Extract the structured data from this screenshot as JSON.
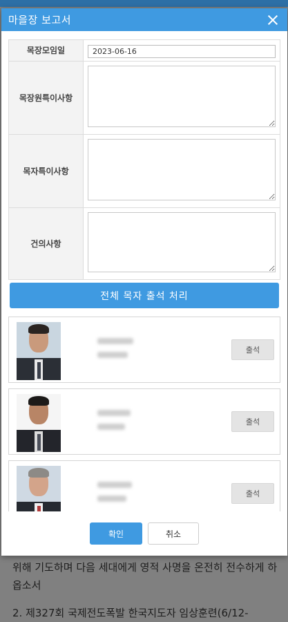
{
  "modal": {
    "title": "마을장 보고서",
    "close_icon": "close-icon"
  },
  "form": {
    "fields": [
      {
        "label": "목장모임일",
        "value": "2023-06-16"
      },
      {
        "label": "목장원특이사항",
        "value": ""
      },
      {
        "label": "목자특이사항",
        "value": ""
      },
      {
        "label": "건의사항",
        "value": ""
      }
    ]
  },
  "all_attend_label": "전체 목자 출석 처리",
  "members": [
    {
      "attend_label": "출석"
    },
    {
      "attend_label": "출석"
    },
    {
      "attend_label": "출석"
    }
  ],
  "footer": {
    "ok_label": "확인",
    "cancel_label": "취소"
  },
  "background": {
    "line1": "위해 기도하며 다음 세대에게 영적 사명을 온전히 전수하게 하옵소서",
    "line2": "2. 제327회 국제전도폭발 한국지도자 임상훈련(6/12-"
  },
  "colors": {
    "accent": "#3f9ae1",
    "overlay": "#808080"
  }
}
